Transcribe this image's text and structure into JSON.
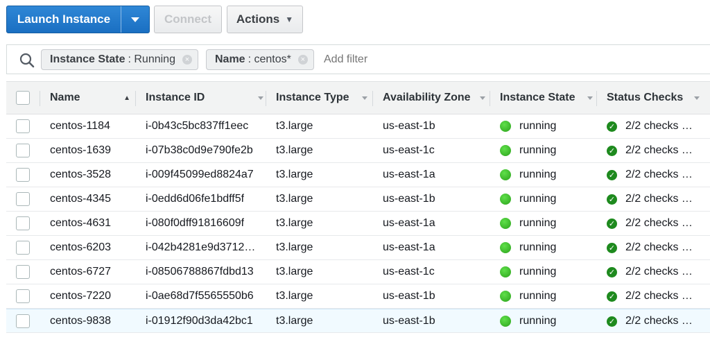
{
  "toolbar": {
    "launch_label": "Launch Instance",
    "connect_label": "Connect",
    "actions_label": "Actions"
  },
  "filters": {
    "chips": [
      {
        "key": "Instance State",
        "value": "Running"
      },
      {
        "key": "Name",
        "value": "centos*"
      }
    ],
    "add_placeholder": "Add filter"
  },
  "table": {
    "columns": [
      "Name",
      "Instance ID",
      "Instance Type",
      "Availability Zone",
      "Instance State",
      "Status Checks"
    ],
    "rows": [
      {
        "name": "centos-1184",
        "id": "i-0b43c5bc837ff1eec",
        "type": "t3.large",
        "zone": "us-east-1b",
        "state": "running",
        "checks": "2/2 checks …"
      },
      {
        "name": "centos-1639",
        "id": "i-07b38c0d9e790fe2b",
        "type": "t3.large",
        "zone": "us-east-1c",
        "state": "running",
        "checks": "2/2 checks …"
      },
      {
        "name": "centos-3528",
        "id": "i-009f45099ed8824a7",
        "type": "t3.large",
        "zone": "us-east-1a",
        "state": "running",
        "checks": "2/2 checks …"
      },
      {
        "name": "centos-4345",
        "id": "i-0edd6d06fe1bdff5f",
        "type": "t3.large",
        "zone": "us-east-1b",
        "state": "running",
        "checks": "2/2 checks …"
      },
      {
        "name": "centos-4631",
        "id": "i-080f0dff91816609f",
        "type": "t3.large",
        "zone": "us-east-1a",
        "state": "running",
        "checks": "2/2 checks …"
      },
      {
        "name": "centos-6203",
        "id": "i-042b4281e9d3712…",
        "type": "t3.large",
        "zone": "us-east-1a",
        "state": "running",
        "checks": "2/2 checks …"
      },
      {
        "name": "centos-6727",
        "id": "i-08506788867fdbd13",
        "type": "t3.large",
        "zone": "us-east-1c",
        "state": "running",
        "checks": "2/2 checks …"
      },
      {
        "name": "centos-7220",
        "id": "i-0ae68d7f5565550b6",
        "type": "t3.large",
        "zone": "us-east-1b",
        "state": "running",
        "checks": "2/2 checks …"
      },
      {
        "name": "centos-9838",
        "id": "i-01912f90d3da42bc1",
        "type": "t3.large",
        "zone": "us-east-1b",
        "state": "running",
        "checks": "2/2 checks …"
      }
    ]
  },
  "colors": {
    "primary": "#1a6fc2",
    "running": "#3ec12a",
    "check": "#1e8a1e",
    "header_bg": "#f2f3f3"
  }
}
